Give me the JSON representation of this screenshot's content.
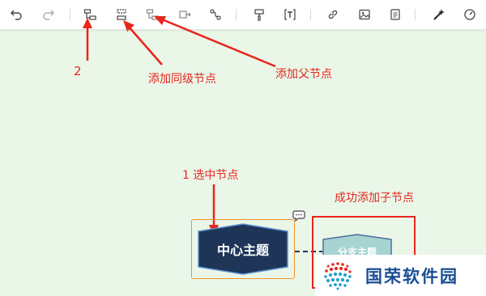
{
  "toolbar": {
    "buttons": [
      {
        "icon": "undo-icon"
      },
      {
        "icon": "redo-icon"
      },
      {
        "icon": "insert-child-node-icon"
      },
      {
        "icon": "insert-sibling-node-icon"
      },
      {
        "icon": "insert-parent-node-icon"
      },
      {
        "icon": "move-node-icon"
      },
      {
        "icon": "relationship-icon"
      },
      {
        "icon": "format-painter-icon"
      },
      {
        "icon": "text-box-icon"
      },
      {
        "icon": "link-icon"
      },
      {
        "icon": "image-icon"
      },
      {
        "icon": "note-icon"
      },
      {
        "icon": "style-magic-icon"
      },
      {
        "icon": "gauge-icon"
      }
    ]
  },
  "annotations": {
    "label_2": "2",
    "add_sibling": "添加同级节点",
    "add_parent": "添加父节点",
    "select_node": "1 选中节点",
    "success_child": "成功添加子节点"
  },
  "canvas": {
    "central_topic": "中心主题",
    "branch_topic": "分支主题"
  },
  "watermark": {
    "brand_text": "国荣软件园"
  },
  "colors": {
    "canvas_bg": "#eaf6e8",
    "annotation_red": "#e8261c",
    "selection_orange": "#f0932b",
    "central_fill": "#1e3558",
    "child_fill": "#a7d3d3",
    "brand_blue": "#1a4e94"
  }
}
